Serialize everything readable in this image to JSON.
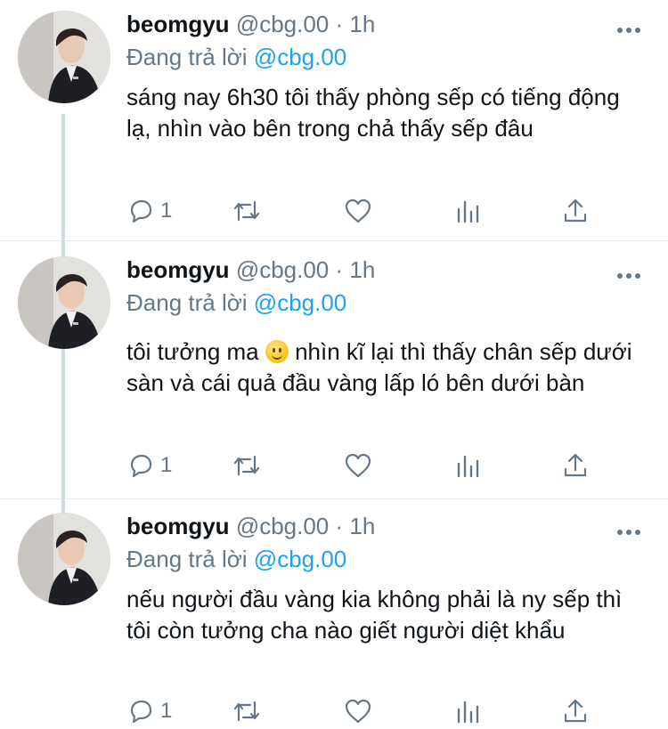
{
  "colors": {
    "text": "#0f1419",
    "meta": "#657786",
    "mention": "#1da1f2",
    "thread_line": "#cfd9de"
  },
  "tweets": [
    {
      "name": "beomgyu",
      "handle": "@cbg.00",
      "separator": "·",
      "time": "1h",
      "reply_prefix": "Đang trả lời",
      "reply_mention": "@cbg.00",
      "text": "sáng nay 6h30 tôi thấy phòng sếp có tiếng động lạ, nhìn vào bên trong chả thấy sếp đâu",
      "reply_count": "1"
    },
    {
      "name": "beomgyu",
      "handle": "@cbg.00",
      "separator": "·",
      "time": "1h",
      "reply_prefix": "Đang trả lời",
      "reply_mention": "@cbg.00",
      "text_before_emoji": "tôi tưởng ma",
      "emoji": "slightly-smiling-face",
      "text_after_emoji": "nhìn kĩ lại thì thấy chân sếp dưới sàn và cái quả đầu vàng lấp ló bên dưới bàn",
      "reply_count": "1"
    },
    {
      "name": "beomgyu",
      "handle": "@cbg.00",
      "separator": "·",
      "time": "1h",
      "reply_prefix": "Đang trả lời",
      "reply_mention": "@cbg.00",
      "text": "nếu người đầu vàng kia không phải là ny sếp thì tôi còn tưởng cha nào giết người diệt khẩu",
      "reply_count": "1"
    }
  ],
  "icons": [
    "reply-icon",
    "retweet-icon",
    "like-icon",
    "analytics-icon",
    "share-icon",
    "more-icon"
  ]
}
